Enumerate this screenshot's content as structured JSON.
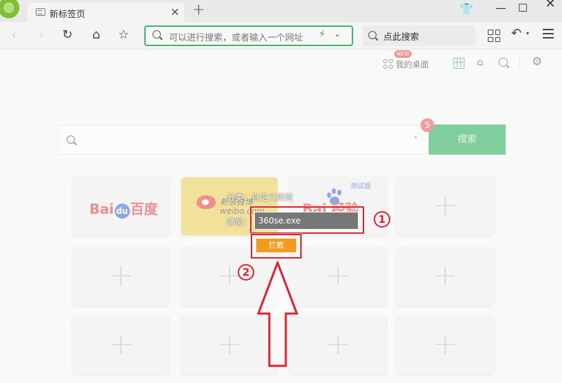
{
  "tab": {
    "title": "新标签页",
    "close": "✕",
    "new_tab": "+"
  },
  "window": {
    "skin_icon": "👕",
    "minimize": "—",
    "maximize": "☐",
    "close": "✕"
  },
  "toolbar": {
    "back": "‹",
    "forward": "›",
    "refresh": "↻",
    "home": "⌂",
    "favorite": "☆",
    "address_placeholder": "可以进行搜索，或者输入一个网址",
    "bolt": "⚡",
    "address_chevron": "⌄",
    "quick_search_label": "点此搜索",
    "undo": "↶",
    "undo_caret": "▾"
  },
  "newtab": {
    "new_badge": "NEW",
    "my_desktop": "我的桌面",
    "home_icon": "⌂",
    "settings_icon": "⚙",
    "search_caret": "▾",
    "search_button": "搜索",
    "notification_count": "5",
    "tiles": [
      {
        "kind": "baidu",
        "logo_left": "Bai",
        "logo_mid": "du",
        "logo_right": "百度"
      },
      {
        "kind": "weibo",
        "line1": "新浪微博",
        "line2": "weibo.com"
      },
      {
        "kind": "jingyan",
        "tag": "测试版",
        "logo": "Bai  经验"
      },
      {
        "kind": "add",
        "label": "+"
      },
      {
        "kind": "add",
        "label": "+"
      },
      {
        "kind": "add",
        "label": "+"
      },
      {
        "kind": "add",
        "label": "+"
      },
      {
        "kind": "add",
        "label": "+"
      },
      {
        "kind": "add",
        "label": "+"
      },
      {
        "kind": "add",
        "label": "+"
      },
      {
        "kind": "add",
        "label": "+"
      },
      {
        "kind": "add",
        "label": "+"
      }
    ]
  },
  "dialog": {
    "category": "分类：自定义规则",
    "popup_label": "弹窗：",
    "popup_value": "360se.exe",
    "block_button": "拦截"
  },
  "annotations": {
    "step1": "1",
    "step2": "2"
  },
  "colors": {
    "accent_green": "#19a74f",
    "annotation_red": "#e11e2b",
    "block_orange": "#f29c1f"
  }
}
